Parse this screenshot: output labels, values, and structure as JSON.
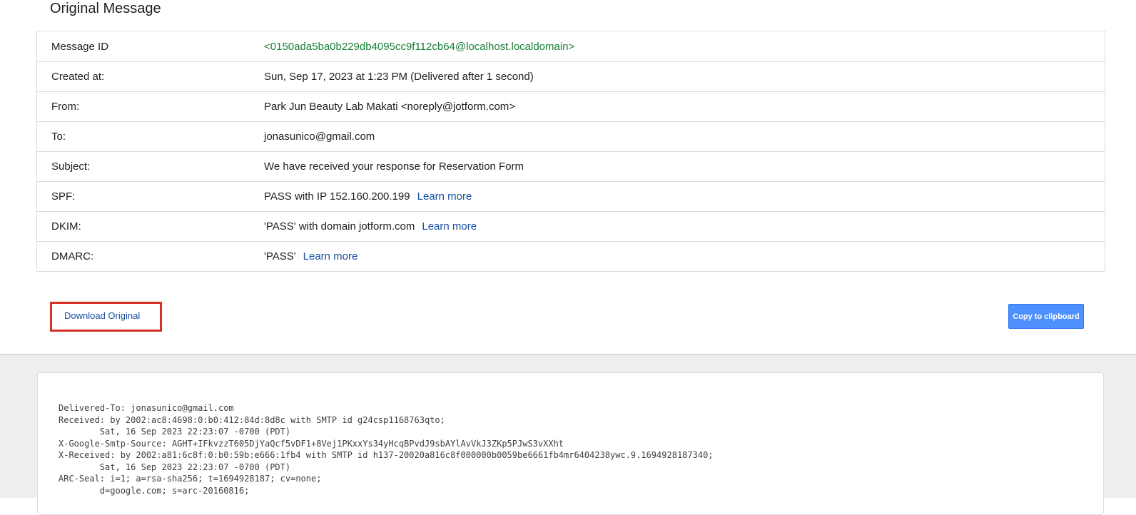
{
  "header": {
    "title": "Original Message"
  },
  "details": [
    {
      "label": "Message ID",
      "value": "<0150ada5ba0b229db4095cc9f112cb64@localhost.localdomain>",
      "link": ""
    },
    {
      "label": "Created at:",
      "value": "Sun, Sep 17, 2023 at 1:23 PM (Delivered after 1 second)",
      "link": ""
    },
    {
      "label": "From:",
      "value": "Park Jun Beauty Lab Makati <noreply@jotform.com>",
      "link": ""
    },
    {
      "label": "To:",
      "value": "jonasunico@gmail.com",
      "link": ""
    },
    {
      "label": "Subject:",
      "value": "We have received your response for Reservation Form",
      "link": ""
    },
    {
      "label": "SPF:",
      "value": "PASS with IP 152.160.200.199",
      "link": "Learn more"
    },
    {
      "label": "DKIM:",
      "value": "'PASS' with domain jotform.com",
      "link": "Learn more"
    },
    {
      "label": "DMARC:",
      "value": "'PASS'",
      "link": "Learn more"
    }
  ],
  "actions": {
    "download_label": "Download Original",
    "copy_label": "Copy to clipboard"
  },
  "raw": {
    "lines": [
      "Delivered-To: jonasunico@gmail.com",
      "Received: by 2002:ac8:4698:0:b0:412:84d:8d8c with SMTP id g24csp1168763qto;",
      "        Sat, 16 Sep 2023 22:23:07 -0700 (PDT)",
      "X-Google-Smtp-Source: AGHT+IFkvzzT605DjYaQcf5vDF1+8Vej1PKxxYs34yHcqBPvdJ9sbAYlAvVkJ3ZKp5PJwS3vXXht",
      "X-Received: by 2002:a81:6c8f:0:b0:59b:e666:1fb4 with SMTP id h137-20020a816c8f000000b0059be6661fb4mr6404238ywc.9.1694928187340;",
      "        Sat, 16 Sep 2023 22:23:07 -0700 (PDT)",
      "ARC-Seal: i=1; a=rsa-sha256; t=1694928187; cv=none;",
      "        d=google.com; s=arc-20160816;"
    ]
  },
  "colors": {
    "message_id": "#188038",
    "link": "#1a4fa3",
    "highlight_box": "#d93025",
    "copy_button": "#4d90fe"
  }
}
